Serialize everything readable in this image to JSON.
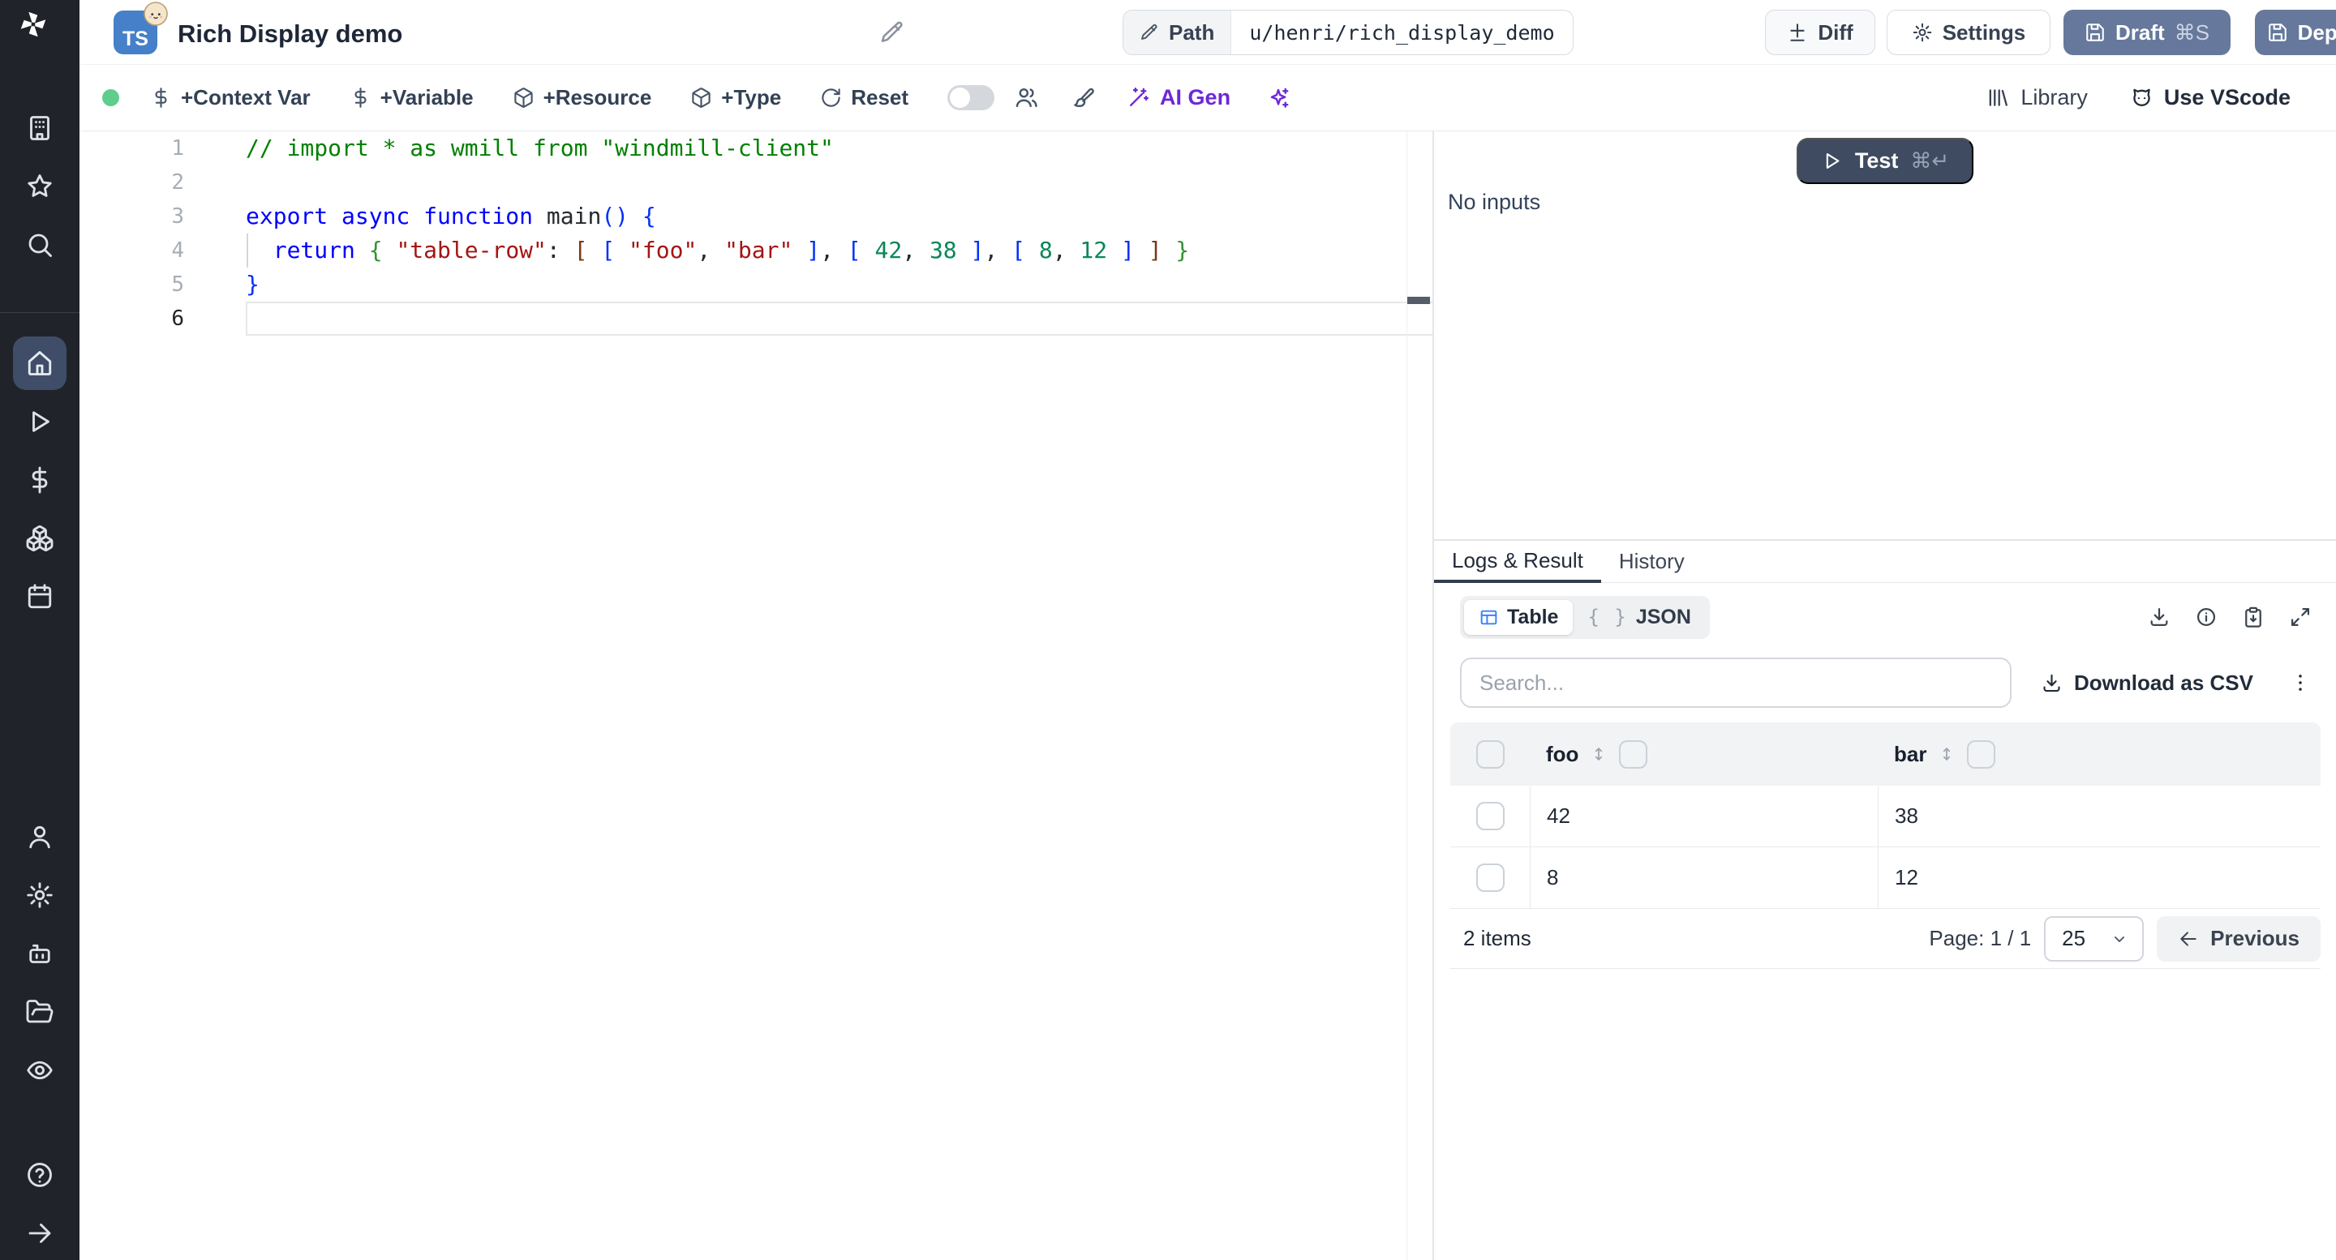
{
  "colors": {
    "sidebar_bg": "#202329",
    "sidebar_active_bg": "#3f4d68",
    "accent_slate": "#66799c",
    "test_button": "#3e4b61",
    "ai_purple": "#6d28d9",
    "table_icon_blue": "#3b82f6",
    "status_green": "#5fcd8c",
    "ts_badge_blue": "#4580c8"
  },
  "sidebar": {
    "top_icons": [
      "building",
      "star",
      "search"
    ],
    "main_icons": [
      {
        "icon": "home",
        "active": true
      },
      {
        "icon": "play",
        "active": false
      },
      {
        "icon": "dollar",
        "active": false
      },
      {
        "icon": "boxes",
        "active": false
      },
      {
        "icon": "calendar",
        "active": false
      }
    ],
    "lower_icons": [
      "user",
      "settings",
      "bot",
      "folder-open",
      "eye"
    ],
    "footer_icons": [
      "help",
      "arrow-right"
    ]
  },
  "topbar": {
    "language_badge": "TS",
    "runtime_badge_icon": "bun-logo",
    "title": "Rich Display demo",
    "path_label": "Path",
    "path_value": "u/henri/rich_display_demo",
    "diff_label": "Diff",
    "settings_label": "Settings",
    "draft_label": "Draft",
    "draft_shortcut": "⌘S",
    "deploy_label": "Deploy"
  },
  "toolbar": {
    "context_var_label": "+Context Var",
    "variable_label": "+Variable",
    "resource_label": "+Resource",
    "type_label": "+Type",
    "reset_label": "Reset",
    "ai_gen_label": "AI Gen",
    "library_label": "Library",
    "vscode_label": "Use VScode"
  },
  "editor": {
    "line_numbers": [
      "1",
      "2",
      "3",
      "4",
      "5",
      "6"
    ],
    "active_line": 6,
    "lines": [
      [
        [
          "// import * as wmill from \"windmill-client\"",
          "comment"
        ]
      ],
      [],
      [
        [
          "export async function ",
          "kw"
        ],
        [
          "main",
          "plain"
        ],
        [
          "(",
          "b1"
        ],
        [
          ")",
          "b1"
        ],
        [
          " ",
          "plain"
        ],
        [
          "{",
          "b1"
        ]
      ],
      [
        [
          "  ",
          "plain"
        ],
        [
          "return",
          "kw"
        ],
        [
          " ",
          "plain"
        ],
        [
          "{",
          "b2"
        ],
        [
          " ",
          "plain"
        ],
        [
          "\"table-row\"",
          "str"
        ],
        [
          ": ",
          "plain"
        ],
        [
          "[",
          "b3"
        ],
        [
          " ",
          "plain"
        ],
        [
          "[",
          "b1"
        ],
        [
          " ",
          "plain"
        ],
        [
          "\"foo\"",
          "str"
        ],
        [
          ", ",
          "plain"
        ],
        [
          "\"bar\"",
          "str"
        ],
        [
          " ",
          "plain"
        ],
        [
          "]",
          "b1"
        ],
        [
          ", ",
          "plain"
        ],
        [
          "[",
          "b1"
        ],
        [
          " ",
          "plain"
        ],
        [
          "42",
          "num"
        ],
        [
          ", ",
          "plain"
        ],
        [
          "38",
          "num"
        ],
        [
          " ",
          "plain"
        ],
        [
          "]",
          "b1"
        ],
        [
          ", ",
          "plain"
        ],
        [
          "[",
          "b1"
        ],
        [
          " ",
          "plain"
        ],
        [
          "8",
          "num"
        ],
        [
          ", ",
          "plain"
        ],
        [
          "12",
          "num"
        ],
        [
          " ",
          "plain"
        ],
        [
          "]",
          "b1"
        ],
        [
          " ",
          "plain"
        ],
        [
          "]",
          "b3"
        ],
        [
          " ",
          "plain"
        ],
        [
          "}",
          "b2"
        ]
      ],
      [
        [
          "}",
          "b1"
        ]
      ],
      []
    ]
  },
  "run_panel": {
    "test_label": "Test",
    "test_shortcut": "⌘↵",
    "no_inputs": "No inputs"
  },
  "result_panel": {
    "tabs": [
      "Logs & Result",
      "History"
    ],
    "active_tab": "Logs & Result",
    "view_table_label": "Table",
    "view_json_label": "JSON",
    "json_braces": "{ }",
    "search_placeholder": "Search...",
    "download_csv_label": "Download as CSV",
    "table": {
      "columns": [
        "foo",
        "bar"
      ],
      "rows": [
        [
          "42",
          "38"
        ],
        [
          "8",
          "12"
        ]
      ]
    },
    "footer": {
      "items_count": "2 items",
      "page": "Page: 1 / 1",
      "page_size": "25",
      "previous_label": "Previous"
    }
  }
}
